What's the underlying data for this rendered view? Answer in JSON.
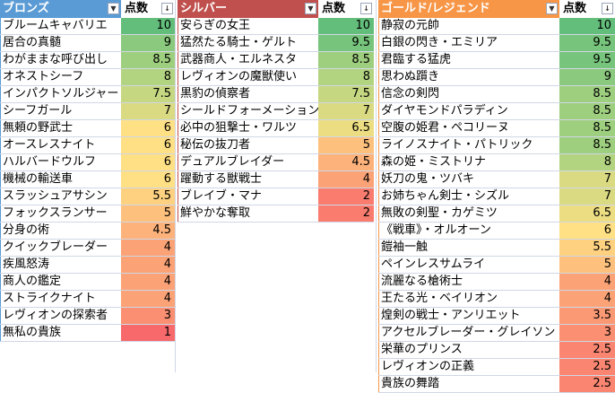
{
  "colors": {
    "bronze_header": "#5b9bd5",
    "silver_header": "#c0504d",
    "gold_header": "#f79646",
    "score_header": "#ffffff",
    "scale_10": "#63be7b",
    "scale_8": "#b2d480",
    "scale_6": "#ffe084",
    "scale_4": "#fba276",
    "scale_2": "#f8696b"
  },
  "tables": [
    {
      "header_name": "ブロンズ",
      "header_score": "点数",
      "rows": [
        {
          "name": "ブルームキャバリエ",
          "score": "10"
        },
        {
          "name": "居合の真髄",
          "score": "9"
        },
        {
          "name": "わがままな呼び出し",
          "score": "8.5"
        },
        {
          "name": "オネストシーフ",
          "score": "8"
        },
        {
          "name": "インパクトソルジャー",
          "score": "7.5"
        },
        {
          "name": "シーフガール",
          "score": "7"
        },
        {
          "name": "無頼の野武士",
          "score": "6"
        },
        {
          "name": "オースレスナイト",
          "score": "6"
        },
        {
          "name": "ハルバードウルフ",
          "score": "6"
        },
        {
          "name": "機械の輸送車",
          "score": "6"
        },
        {
          "name": "スラッシュアサシン",
          "score": "5.5"
        },
        {
          "name": "フォックスランサー",
          "score": "5"
        },
        {
          "name": "分身の術",
          "score": "4.5"
        },
        {
          "name": "クイックブレーダー",
          "score": "4"
        },
        {
          "name": "疾風怒涛",
          "score": "4"
        },
        {
          "name": "商人の鑑定",
          "score": "4"
        },
        {
          "name": "ストライクナイト",
          "score": "4"
        },
        {
          "name": "レヴィオンの探索者",
          "score": "3"
        },
        {
          "name": "無私の貴族",
          "score": "1"
        }
      ]
    },
    {
      "header_name": "シルバー",
      "header_score": "点数",
      "rows": [
        {
          "name": "安らぎの女王",
          "score": "10"
        },
        {
          "name": "猛然たる騎士・ゲルト",
          "score": "9.5"
        },
        {
          "name": "武器商人・エルネスタ",
          "score": "8.5"
        },
        {
          "name": "レヴィオンの魔獣使い",
          "score": "8"
        },
        {
          "name": "黒豹の偵察者",
          "score": "7.5"
        },
        {
          "name": "シールドフォーメーション",
          "score": "7"
        },
        {
          "name": "必中の狙撃士・ワルツ",
          "score": "6.5"
        },
        {
          "name": "秘伝の抜刀者",
          "score": "5"
        },
        {
          "name": "デュアルブレイダー",
          "score": "4.5"
        },
        {
          "name": "躍動する獣戦士",
          "score": "4"
        },
        {
          "name": "ブレイブ・マナ",
          "score": "2"
        },
        {
          "name": "鮮やかな奪取",
          "score": "2"
        }
      ]
    },
    {
      "header_name": "ゴールド/レジェンド",
      "header_score": "点数",
      "rows": [
        {
          "name": "静寂の元帥",
          "score": "10"
        },
        {
          "name": "白銀の閃き・エミリア",
          "score": "9.5"
        },
        {
          "name": "君臨する猛虎",
          "score": "9.5"
        },
        {
          "name": "思わぬ躓き",
          "score": "9"
        },
        {
          "name": "信念の剣閃",
          "score": "8.5"
        },
        {
          "name": "ダイヤモンドパラディン",
          "score": "8.5"
        },
        {
          "name": "空腹の姫君・ペコリーヌ",
          "score": "8.5"
        },
        {
          "name": "ライノスナイト・パトリック",
          "score": "8.5"
        },
        {
          "name": "森の姫・ミストリナ",
          "score": "8"
        },
        {
          "name": "妖刀の鬼・ツバキ",
          "score": "7"
        },
        {
          "name": "お姉ちゃん剣士・シズル",
          "score": "7"
        },
        {
          "name": "無敗の剣聖・カゲミツ",
          "score": "6.5"
        },
        {
          "name": "《戦車》・オルオーン",
          "score": "6"
        },
        {
          "name": "鎧袖一触",
          "score": "5.5"
        },
        {
          "name": "ペインレスサムライ",
          "score": "5"
        },
        {
          "name": "流麗なる槍術士",
          "score": "4"
        },
        {
          "name": "王たる光・ベイリオン",
          "score": "4"
        },
        {
          "name": "煌剣の戦士・アンリエット",
          "score": "3.5"
        },
        {
          "name": "アクセルブレーダー・グレイソン",
          "score": "3"
        },
        {
          "name": "栄華のプリンス",
          "score": "2.5"
        },
        {
          "name": "レヴィオンの正義",
          "score": "2.5"
        },
        {
          "name": "貴族の舞踏",
          "score": "2.5"
        }
      ]
    }
  ]
}
